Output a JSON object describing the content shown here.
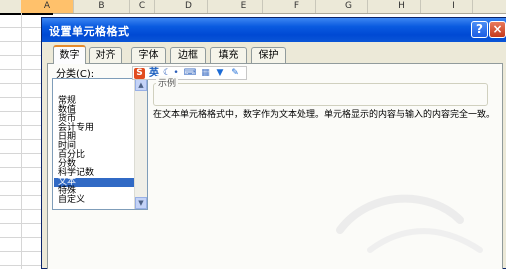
{
  "sheet": {
    "columns": [
      "A",
      "B",
      "C",
      "D",
      "E",
      "F",
      "G",
      "H",
      "I"
    ],
    "active_column": "A"
  },
  "dialog": {
    "title": "设置单元格格式",
    "help_symbol": "?",
    "close_symbol": "×",
    "tabs": [
      {
        "label": "数字",
        "selected": true
      },
      {
        "label": "对齐",
        "selected": false
      },
      {
        "label": "字体",
        "selected": false
      },
      {
        "label": "边框",
        "selected": false
      },
      {
        "label": "填充",
        "selected": false
      },
      {
        "label": "保护",
        "selected": false
      }
    ],
    "category_label": "分类(C):",
    "categories": [
      "常规",
      "数值",
      "货币",
      "会计专用",
      "日期",
      "时间",
      "百分比",
      "分数",
      "科学记数",
      "文本",
      "特殊",
      "自定义"
    ],
    "selected_category": "文本",
    "sample_label": "示例",
    "description": "在文本单元格格式中，数字作为文本处理。单元格显示的内容与输入的内容完全一致。"
  },
  "ime_toolbar": {
    "logo": "S",
    "mode": "英",
    "icons": [
      "moon-icon",
      "dot-icon",
      "keyboard-icon",
      "grid-icon",
      "shirt-icon",
      "wrench-icon"
    ]
  },
  "colors": {
    "title_bar": "#0a5be0",
    "selected_category": "#316ac5",
    "dialog_face": "#ece9d8",
    "active_tab_accent": "#e68b2c"
  }
}
